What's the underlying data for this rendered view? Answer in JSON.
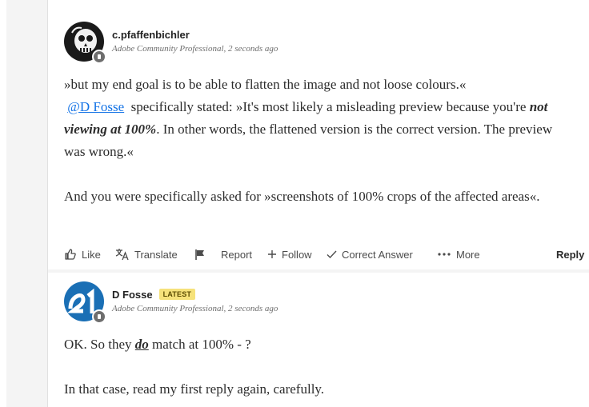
{
  "post1": {
    "author": "c.pfaffenbichler",
    "role": "Adobe Community Professional",
    "time": "2 seconds ago",
    "p1": "»but my end goal is to be able to flatten the image and not loose colours.«",
    "mention": "@D Fosse",
    "p2a": "specifically stated: »It's most likely a misleading preview because you're",
    "p2em": "not viewing at 100%",
    "p2b": ". In other words, the flattened version is the correct version. The preview was wrong.«",
    "p3": "And you were specifically asked for »screenshots of 100% crops of the affected areas«.",
    "actions": {
      "like": "Like",
      "translate": "Translate",
      "report": "Report",
      "follow": "Follow",
      "correct": "Correct Answer",
      "more": "More",
      "reply": "Reply"
    }
  },
  "post2": {
    "author": "D Fosse",
    "badge": "LATEST",
    "role": "Adobe Community Professional",
    "time": "2 seconds ago",
    "p1a": "OK. So they ",
    "p1em": "do",
    "p1b": " match at 100% - ?",
    "p2": "In that case, read my first reply again, carefully."
  },
  "colors": {
    "link": "#1473e6",
    "badge": "#f6e27a",
    "avatar2": "#1a6fb5"
  }
}
